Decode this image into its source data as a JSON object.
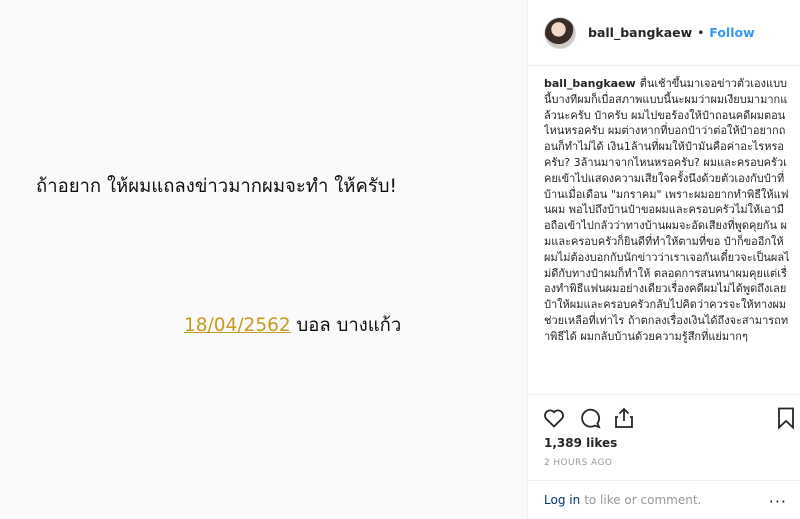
{
  "post_image": {
    "headline": "ถ้าอยาก ให้ผมแถลงข่าวมากผมจะทำ ให้ครับ!",
    "signature_date": "18/04/2562",
    "signature_name": " บอล บางแก้ว"
  },
  "header": {
    "username": "ball_bangkaew",
    "separator": "•",
    "follow_label": "Follow"
  },
  "caption": {
    "username": "ball_bangkaew",
    "text": "ตื่นเช้าขึ้นมาเจอข่าวตัวเองแบบนี้บางทีผมก็เบื่อสภาพแบบนี้นะผมว่าผมเงียบมามากแล้วนะครับ ป๋าครับ ผมไปขอร้องให้ป๋าถอนคดีผมตอนไหนหรอครับ ผมต่างหากที่บอกป๋าว่าต่อให้ป๋าอยากถอนก็ทำไม่ได้ เงิน1ล้านที่ผมให้ป๋ามันคือค่าอะไรหรอครับ? 3ล้านมาจากไหนหรอครับ? ผมและครอบครัวเคยเข้าไปแสดงความเสียใจครั้งนึงด้วยตัวเองกับป๋าที่บ้านเมื่อเดือน \"มกราคม\" เพราะผมอยากทำพิธีให้แฟนผม พอไปถึงบ้านป๋าขอผมและครอบครัวไม่ให้เอามือถือเข้าไปกลัวว่าทางบ้านผมจะอัดเสียงที่พูดคุยกัน ผมและครอบครัวก็ยินดีที่ทำให้ตามที่ขอ ป๋าก็ขออีกให้ผมไม่ต้องบอกกับนักข่าวว่าเราเจอกันเดี๋ยวจะเป็นผลไม่ดีกับทางป๋าผมก็ทำให้ ตลอดการสนทนาผมคุยแต่เรื่องทำพิธีแฟนผมอย่างเดียวเรื่องคดีผมไม่ได้พูดถึงเลย ป๋าให้ผมและครอบครัวกลับไปคิดว่าควรจะให้ทางผมช่วยเหลือที่เท่าไร ถ้าตกลงเรื่องเงินได้ถึงจะสามารถทำพิธีได้ ผมกลับบ้านด้วยความรู้สึกที่แย่มากๆ"
  },
  "actions": {
    "like_icon": "heart-icon",
    "comment_icon": "comment-icon",
    "share_icon": "share-icon",
    "save_icon": "bookmark-icon"
  },
  "likes_label": "1,389 likes",
  "time_label": "2 HOURS AGO",
  "footer": {
    "login_label": "Log in",
    "rest_label": "to like or comment.",
    "more_label": "···"
  }
}
